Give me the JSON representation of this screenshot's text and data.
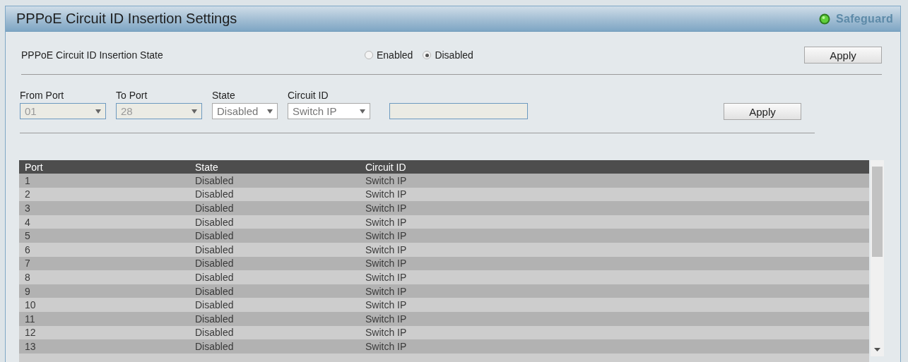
{
  "panel": {
    "title": "PPPoE Circuit ID Insertion Settings",
    "badge": "Safeguard"
  },
  "global_state": {
    "label": "PPPoE Circuit ID Insertion State",
    "options": [
      {
        "label": "Enabled",
        "selected": false
      },
      {
        "label": "Disabled",
        "selected": true
      }
    ],
    "apply": "Apply"
  },
  "port_settings": {
    "fields": [
      {
        "label": "From Port",
        "value": "01",
        "disabled": true
      },
      {
        "label": "To Port",
        "value": "28",
        "disabled": true
      },
      {
        "label": "State",
        "value": "Disabled",
        "disabled": false
      },
      {
        "label": "Circuit ID",
        "value": "Switch IP",
        "disabled": false
      }
    ],
    "circuit_text_field": {
      "disabled": true
    },
    "apply": "Apply"
  },
  "table": {
    "columns": [
      "Port",
      "State",
      "Circuit ID"
    ],
    "rows": [
      [
        "1",
        "Disabled",
        "Switch IP"
      ],
      [
        "2",
        "Disabled",
        "Switch IP"
      ],
      [
        "3",
        "Disabled",
        "Switch IP"
      ],
      [
        "4",
        "Disabled",
        "Switch IP"
      ],
      [
        "5",
        "Disabled",
        "Switch IP"
      ],
      [
        "6",
        "Disabled",
        "Switch IP"
      ],
      [
        "7",
        "Disabled",
        "Switch IP"
      ],
      [
        "8",
        "Disabled",
        "Switch IP"
      ],
      [
        "9",
        "Disabled",
        "Switch IP"
      ],
      [
        "10",
        "Disabled",
        "Switch IP"
      ],
      [
        "11",
        "Disabled",
        "Switch IP"
      ],
      [
        "12",
        "Disabled",
        "Switch IP"
      ],
      [
        "13",
        "Disabled",
        "Switch IP"
      ]
    ]
  }
}
